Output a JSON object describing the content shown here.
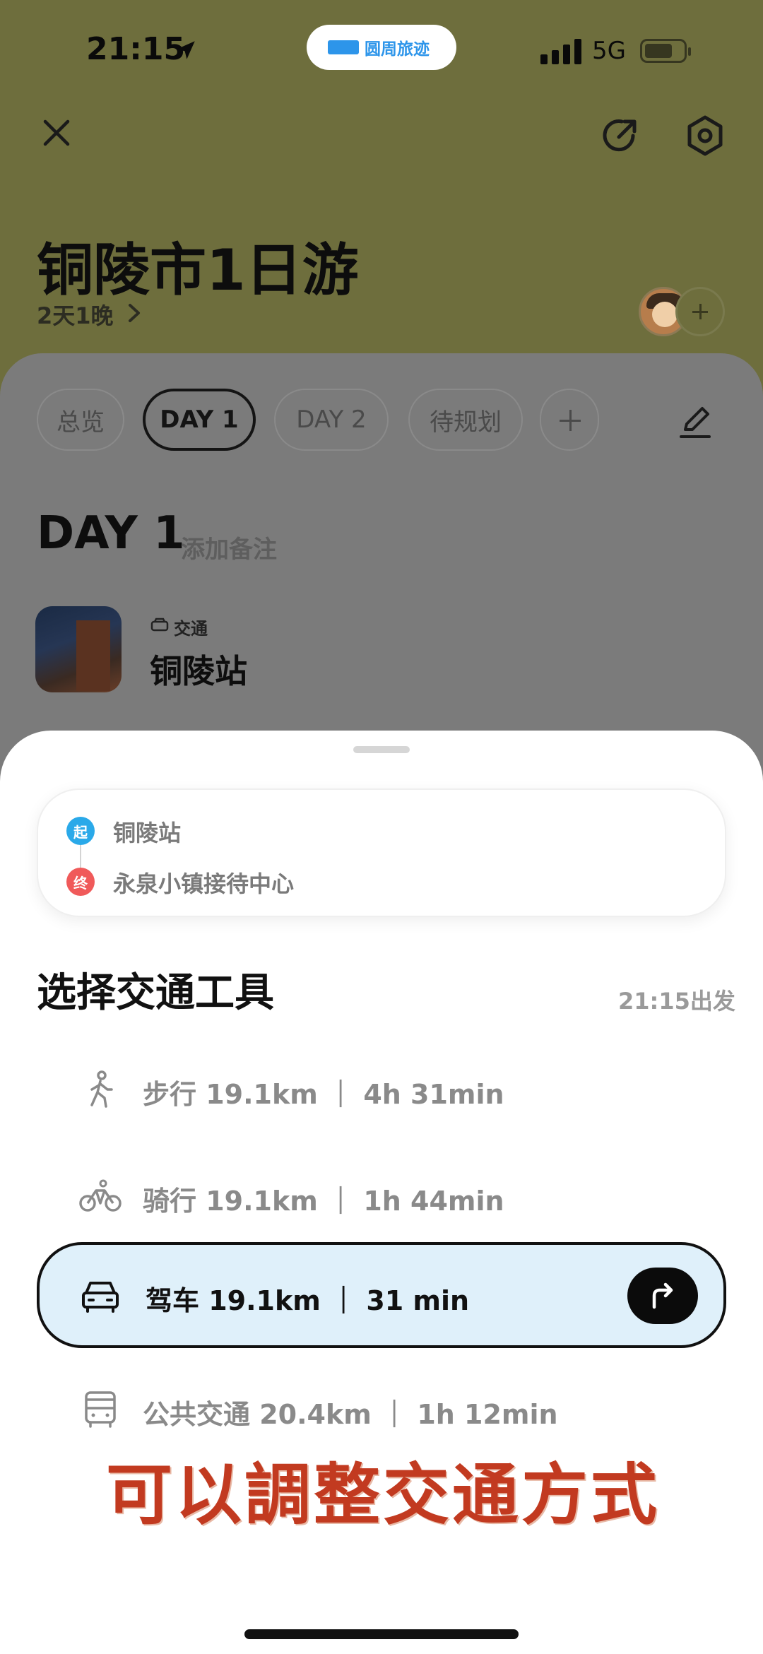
{
  "status_bar": {
    "time": "21:15",
    "app_name": "圆周旅迹",
    "network": "5G",
    "brand_color": "#2d95ea"
  },
  "header": {
    "title": "铜陵市1日游",
    "duration": "2天1晚"
  },
  "tabs": [
    {
      "label": "总览"
    },
    {
      "label": "DAY 1"
    },
    {
      "label": "DAY 2"
    },
    {
      "label": "待规划"
    }
  ],
  "day": {
    "heading": "DAY 1",
    "note_placeholder": "添加备注",
    "place": {
      "type": "交通",
      "name": "铜陵站"
    }
  },
  "route": {
    "start_badge": "起",
    "end_badge": "终",
    "from": "铜陵站",
    "to": "永泉小镇接待中心",
    "start_color": "#2aa9e9",
    "end_color": "#f05a5a"
  },
  "transport": {
    "title": "选择交通工具",
    "depart": "21:15出发",
    "modes": [
      {
        "icon": "walk-icon",
        "label": "步行 19.1km ｜ 4h 31min"
      },
      {
        "icon": "bike-icon",
        "label": "骑行 19.1km ｜ 1h 44min"
      },
      {
        "icon": "car-icon",
        "label": "驾车 19.1km ｜ 31 min"
      },
      {
        "icon": "bus-icon",
        "label": "公共交通 20.4km ｜ 1h 12min"
      }
    ],
    "selected_color": "#dff0fa"
  },
  "promo_text": "可以調整交通方式"
}
